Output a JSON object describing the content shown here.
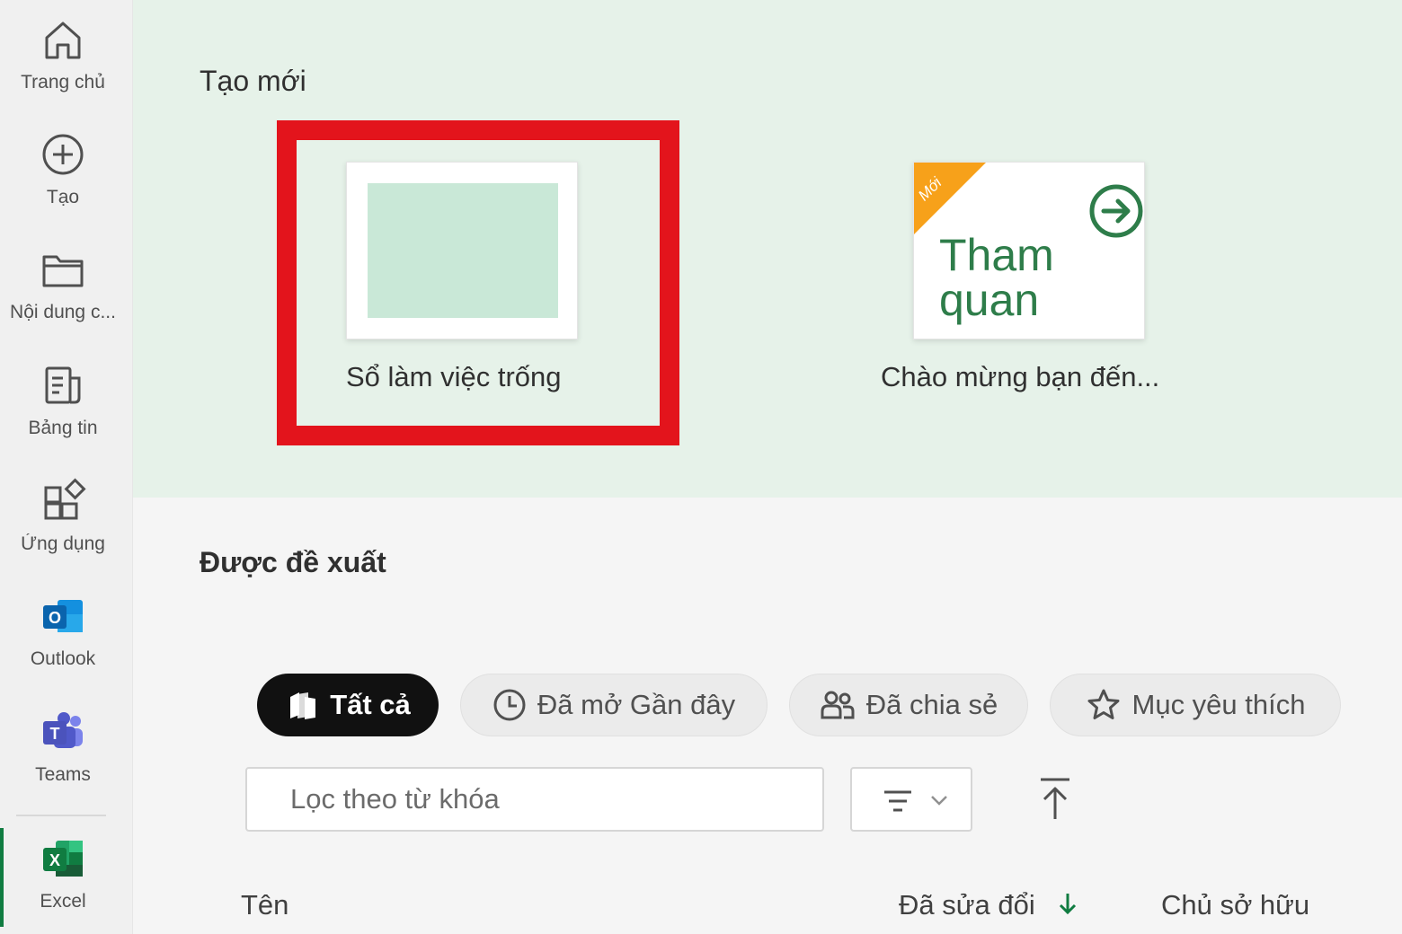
{
  "sidebar": {
    "items": [
      {
        "label": "Trang chủ",
        "icon": "home-icon"
      },
      {
        "label": "Tạo",
        "icon": "add-circle-icon"
      },
      {
        "label": "Nội dung c...",
        "icon": "folder-icon"
      },
      {
        "label": "Bảng tin",
        "icon": "news-feed-icon"
      },
      {
        "label": "Ứng dụng",
        "icon": "apps-icon"
      },
      {
        "label": "Outlook",
        "icon": "outlook-icon"
      },
      {
        "label": "Teams",
        "icon": "teams-icon"
      },
      {
        "label": "Excel",
        "icon": "excel-icon"
      }
    ],
    "active": "Excel"
  },
  "create": {
    "title": "Tạo mới",
    "templates": [
      {
        "name": "Sổ làm việc trống"
      },
      {
        "name": "Chào mừng bạn đến...",
        "thumb_text": [
          "Tham",
          "quan"
        ],
        "badge": "Mới"
      }
    ]
  },
  "suggested": {
    "title": "Được đề xuất",
    "filters": [
      {
        "label": "Tất cả",
        "icon": "all-files-icon",
        "selected": true
      },
      {
        "label": "Đã mở Gần đây",
        "icon": "clock-icon",
        "selected": false
      },
      {
        "label": "Đã chia sẻ",
        "icon": "people-icon",
        "selected": false
      },
      {
        "label": "Mục yêu thích",
        "icon": "star-icon",
        "selected": false
      }
    ],
    "search_placeholder": "Lọc theo từ khóa",
    "columns": {
      "name": "Tên",
      "modified": "Đã sửa đổi",
      "owner": "Chủ sở hữu"
    }
  },
  "colors": {
    "accent": "#107c41",
    "highlight": "#e3141c",
    "create_bg": "#e6f2e9",
    "badge": "#f7a11a"
  }
}
